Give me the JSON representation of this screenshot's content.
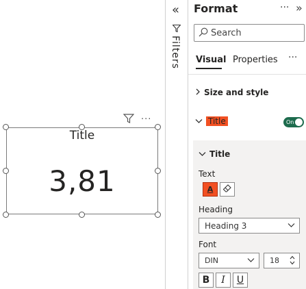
{
  "card": {
    "title": "Title",
    "value": "3,81"
  },
  "filters_pane": {
    "label": "Filters",
    "collapse_icon": "double-chevron-left-icon"
  },
  "format_pane": {
    "title": "Format",
    "more": "···",
    "expand_icon": "double-chevron-right-icon",
    "search": {
      "placeholder": "Search"
    },
    "tabs": [
      {
        "label": "Visual",
        "active": true
      },
      {
        "label": "Properties",
        "active": false
      }
    ],
    "tabs_more": "···",
    "sections": {
      "size_and_style": "Size and style",
      "title": "Title",
      "title_toggle": "On"
    },
    "title_card": {
      "heading": "Title",
      "text_label": "Text",
      "heading_label": "Heading",
      "heading_value": "Heading 3",
      "font_label": "Font",
      "font_value": "DIN",
      "font_size": "18",
      "bold": "B",
      "italic": "I",
      "underline": "U"
    }
  },
  "colors": {
    "accent_orange": "#f25022",
    "toggle_green": "#1d6b4d"
  }
}
